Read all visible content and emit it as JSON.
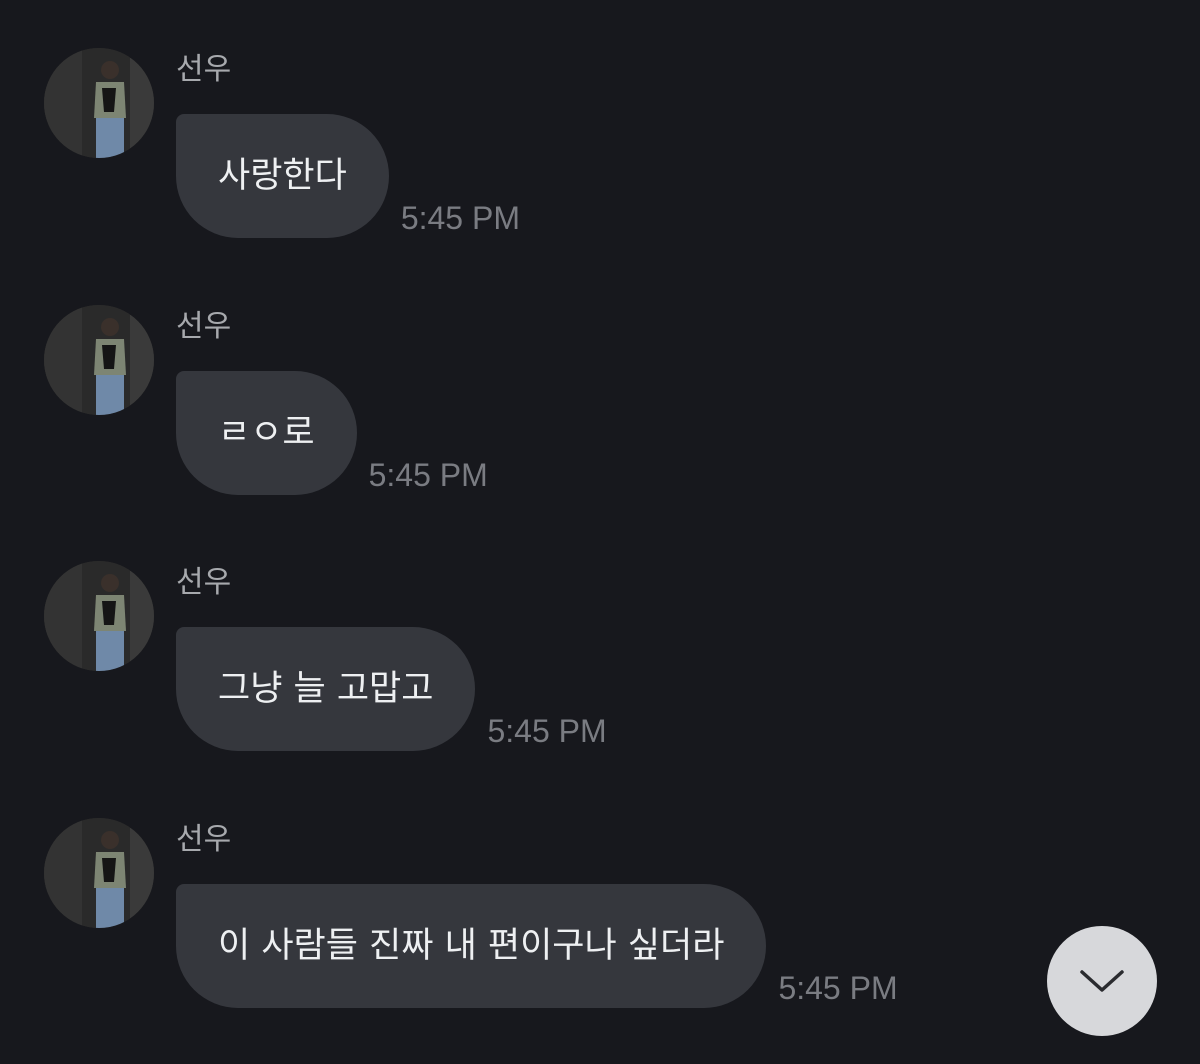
{
  "messages": [
    {
      "sender": "선우",
      "text": "사랑한다",
      "time": "5:45 PM"
    },
    {
      "sender": "선우",
      "text": "ㄹㅇ로",
      "time": "5:45 PM"
    },
    {
      "sender": "선우",
      "text": "그냥 늘 고맙고",
      "time": "5:45 PM"
    },
    {
      "sender": "선우",
      "text": "이 사람들 진짜 내 편이구나 싶더라",
      "time": "5:45 PM"
    }
  ],
  "scroll_button": {
    "icon": "chevron-down-icon"
  },
  "colors": {
    "background": "#17181d",
    "bubble": "#35373d",
    "text": "#eef0f2",
    "sender": "#a7a9ad",
    "time": "#7a7c82",
    "scroll_button": "#d7d8db"
  }
}
